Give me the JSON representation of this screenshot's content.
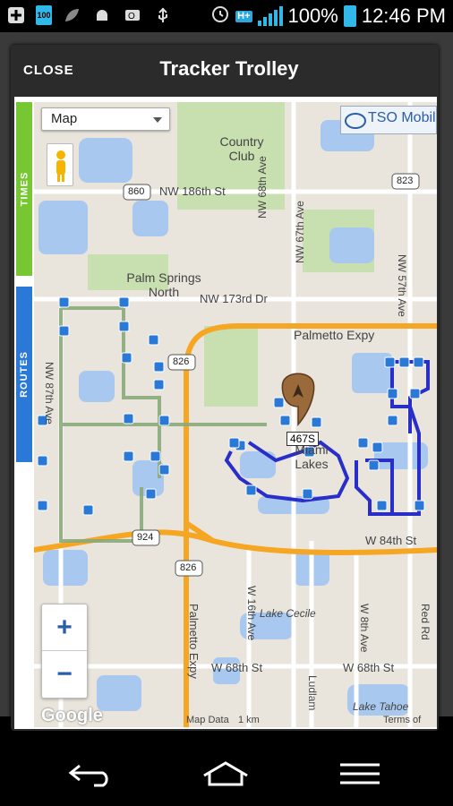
{
  "status_bar": {
    "battery_small_label": "100",
    "battery_percent": "100%",
    "time": "12:46 PM",
    "network_badge": "H+"
  },
  "dialog": {
    "close_label": "CLOSE",
    "title": "Tracker Trolley"
  },
  "side_tabs": {
    "times": "TIMES",
    "routes": "ROUTES"
  },
  "map": {
    "map_type": "Map",
    "provider_logo": "TSO Mobile",
    "attribution_left": "Google",
    "attribution_center": "Map Data",
    "attribution_scale": "1 km",
    "attribution_right": "Terms of",
    "vehicle_label": "467S",
    "labels": {
      "country_club": "Country Club",
      "nw186": "NW 186th St",
      "hwy860": "860",
      "hwy823": "823",
      "hwy826a": "826",
      "hwy826b": "826",
      "hwy924": "924",
      "palm_springs": "Palm Springs North",
      "nw173": "NW 173rd Dr",
      "nw68": "NW 68th Ave",
      "nw67": "NW 67th Ave",
      "nw57": "NW 57th Ave",
      "nw87": "NW 87th Ave",
      "palmetto_expy": "Palmetto Expy",
      "palmetto_expy2": "Palmetto Expy",
      "miami_lakes": "Miami Lakes",
      "w84": "W 84th St",
      "w16": "W 16th Ave",
      "w8": "W 8th Ave",
      "lake_cecile": "Lake Cecile",
      "w68a": "W 68th St",
      "w68b": "W 68th St",
      "lake_tahoe": "Lake Tahoe",
      "red_rd": "Red Rd",
      "ludlam": "Ludlam"
    }
  },
  "zoom": {
    "in_label": "+",
    "out_label": "−"
  },
  "colors": {
    "times_tab": "#76c732",
    "routes_tab": "#2b79d6",
    "route_active": "#2a2ec8",
    "route_inactive": "#8aa97a",
    "expressway": "#f5a623",
    "water": "#a9c8f0",
    "park": "#c8dfb0"
  }
}
